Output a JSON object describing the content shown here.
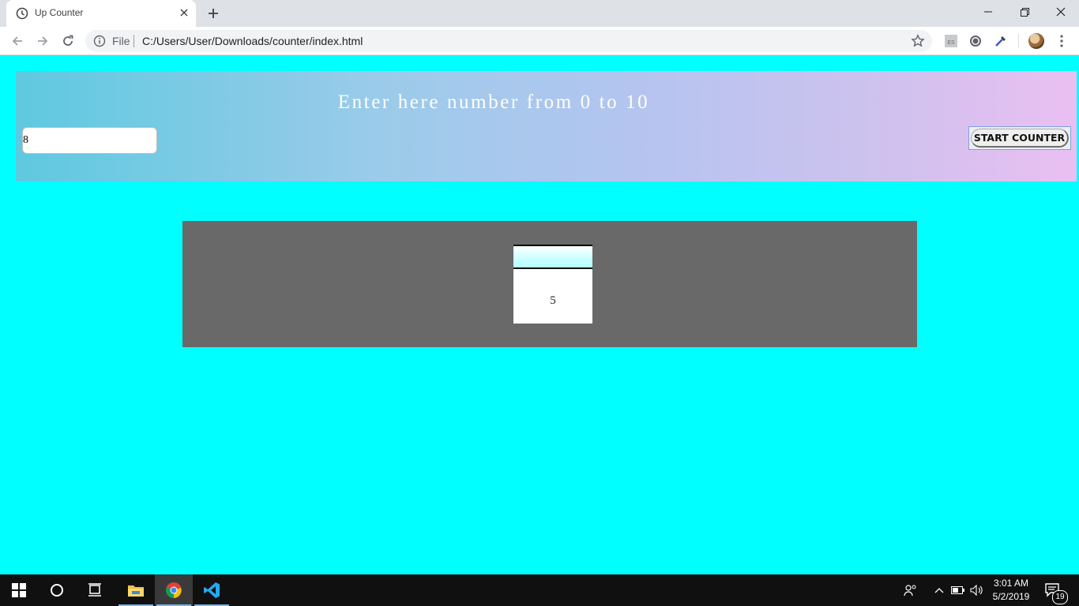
{
  "browser": {
    "tab_title": "Up Counter",
    "tab_close_icon": "close-icon",
    "new_tab_icon": "plus-icon",
    "omnibox": {
      "scheme_label": "File",
      "url": "C:/Users/User/Downloads/counter/index.html"
    },
    "extension_badge": "ES"
  },
  "page": {
    "heading": "Enter here number from 0 to 10",
    "number_input_value": "8",
    "start_button_label": "START COUNTER",
    "counter_value": "5",
    "colors": {
      "page_background": "#00ffff",
      "panel_gradient_start": "#5ec9e0",
      "panel_gradient_end": "#eabff2",
      "counter_panel": "#696969"
    }
  },
  "taskbar": {
    "time": "3:01 AM",
    "date": "5/2/2019",
    "notification_count": "19"
  }
}
